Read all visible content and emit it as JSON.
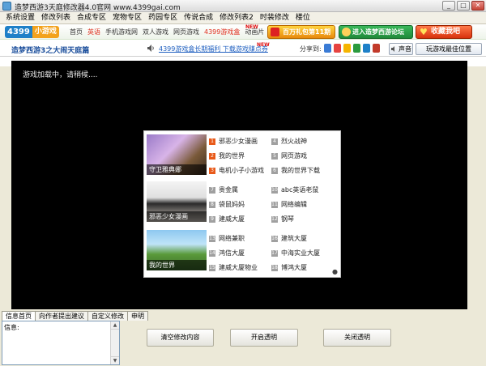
{
  "window": {
    "title": "造梦西游3天庭修改器4.0官网 www.4399gai.com"
  },
  "menu": [
    "系统设置",
    "修改列表",
    "合成专区",
    "宠物专区",
    "药园专区",
    "传说合成",
    "修改列表2",
    "时装修改",
    "楼位"
  ],
  "site": {
    "logo_main": "4399",
    "logo_sub": "小游戏",
    "nav": [
      "首页",
      "英语",
      "手机游戏网",
      "双人游戏",
      "网页游戏",
      "4399游戏盒",
      "动画片"
    ],
    "nav_new": "NEW",
    "gift_label": "百万礼包第11期",
    "forum_label": "进入造梦西游论坛",
    "fav_label": "收藏我吧"
  },
  "gamebar": {
    "title": "造梦西游3之大闹天庭篇",
    "promo": "4399游戏盒长期福利  下载游戏赚点券",
    "promo_new": "NEW",
    "share_label": "分享到:",
    "sound_label": "声音",
    "flow_label": "玩游戏最佳位置"
  },
  "game": {
    "loading_text": "游戏加载中，请稍候....",
    "groups": [
      {
        "thumb_caption": "守卫雅典娜",
        "items": [
          {
            "num": "1",
            "label": "邪恶少女漫画",
            "hot": true
          },
          {
            "num": "2",
            "label": "我的世界",
            "hot": true
          },
          {
            "num": "3",
            "label": "电机小子小游戏",
            "hot": true
          },
          {
            "num": "4",
            "label": "烈火战神",
            "hot": false
          },
          {
            "num": "5",
            "label": "网页游戏",
            "hot": false
          },
          {
            "num": "6",
            "label": "我的世界下载",
            "hot": false
          }
        ]
      },
      {
        "thumb_caption": "邪恶少女漫画",
        "items": [
          {
            "num": "7",
            "label": "贵金属",
            "hot": false
          },
          {
            "num": "8",
            "label": "袋鼠妈妈",
            "hot": false
          },
          {
            "num": "9",
            "label": "建威大厦",
            "hot": false
          },
          {
            "num": "10",
            "label": "abc英语老鼠",
            "hot": false
          },
          {
            "num": "11",
            "label": "网络编辑",
            "hot": false
          },
          {
            "num": "12",
            "label": "钢琴",
            "hot": false
          }
        ]
      },
      {
        "thumb_caption": "我的世界",
        "items": [
          {
            "num": "13",
            "label": "网络兼职",
            "hot": false
          },
          {
            "num": "14",
            "label": "鸿信大厦",
            "hot": false
          },
          {
            "num": "15",
            "label": "建威大厦物业",
            "hot": false
          },
          {
            "num": "16",
            "label": "建筑大厦",
            "hot": false
          },
          {
            "num": "17",
            "label": "中海实业大厦",
            "hot": false
          },
          {
            "num": "18",
            "label": "博鸿大厦",
            "hot": false
          }
        ]
      }
    ]
  },
  "bottom": {
    "tabs": [
      "信息首页",
      "向作者提出建议",
      "自定义修改",
      "申明"
    ],
    "info_label": "信息:",
    "buttons": [
      "清空修改内容",
      "开启透明",
      "关闭透明"
    ]
  },
  "colors": {
    "accent": "#1e80c8",
    "hot": "#e85a1a",
    "game_bg": "#000000"
  }
}
